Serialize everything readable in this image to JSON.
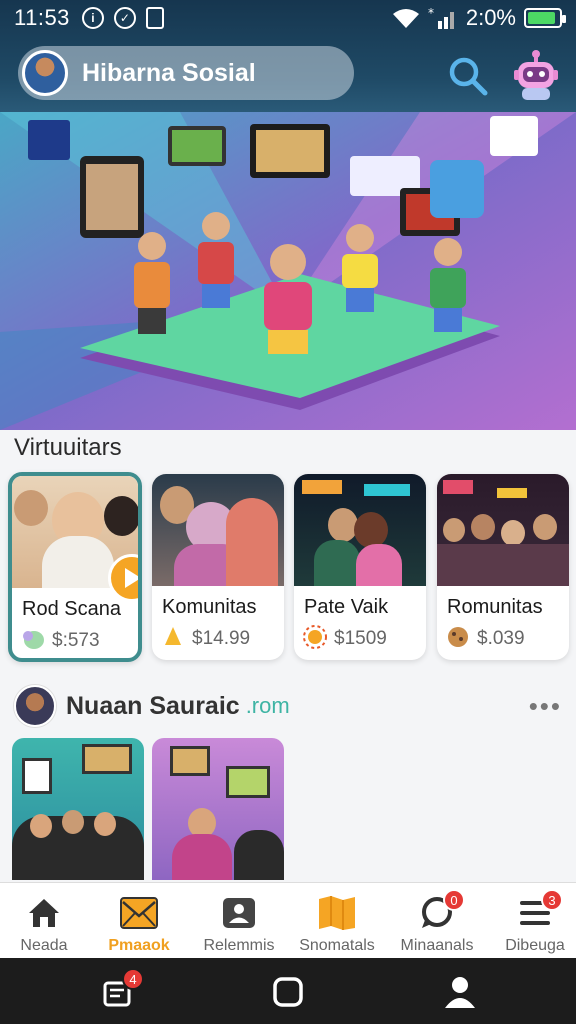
{
  "status_bar": {
    "time": "11:53",
    "battery": "2:0%",
    "battery_level": 0.9,
    "icons": [
      "info-icon",
      "check-circle-icon",
      "sim-icon",
      "wifi-icon",
      "signal-icon",
      "battery-icon"
    ]
  },
  "header": {
    "title": "Hibarna Sosial"
  },
  "section": {
    "title": "Virtuuitars"
  },
  "cards": [
    {
      "name": "Rod Scana",
      "price": "$:573",
      "icon": "elephant-icon"
    },
    {
      "name": "Komunitas",
      "price": "$14.99",
      "icon": "bell-icon"
    },
    {
      "name": "Pate Vaik",
      "price": "$1509",
      "icon": "sun-icon"
    },
    {
      "name": "Romunitas",
      "price": "$.039",
      "icon": "cookie-icon"
    }
  ],
  "post": {
    "author": "Nuaan Sauraic",
    "domain": ".rom"
  },
  "bottom_nav": [
    {
      "label": "Neada",
      "icon": "home-icon"
    },
    {
      "label": "Pmaaok",
      "icon": "mail-icon",
      "active": true
    },
    {
      "label": "Relemmis",
      "icon": "contacts-icon"
    },
    {
      "label": "Snomatals",
      "icon": "map-icon"
    },
    {
      "label": "Minaanals",
      "icon": "chat-icon",
      "badge": "0"
    },
    {
      "label": "Dibeuga",
      "icon": "menu-icon",
      "badge": "3"
    }
  ],
  "system_bar": {
    "left_badge": "4"
  },
  "colors": {
    "appbar": "#1f4a66",
    "accent_orange": "#f5a524",
    "selected_card_border": "#3f8d8e",
    "badge_red": "#e53935"
  }
}
